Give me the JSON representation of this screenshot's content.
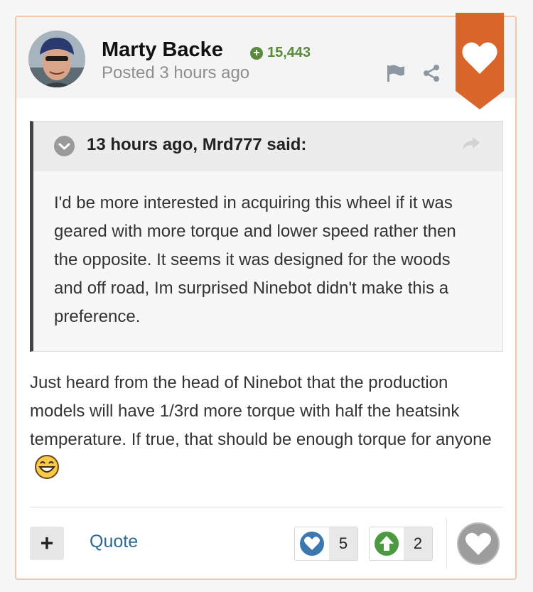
{
  "post": {
    "author": "Marty Backe",
    "reputation": "15,443",
    "posted": "Posted 3 hours ago",
    "quote": {
      "cite": "13 hours ago, Mrd777 said:",
      "text": "I'd be more interested in acquiring this wheel if it was geared with more torque and lower speed rather then the opposite. It seems it was designed for the woods and off road, Im surprised Ninebot didn't make this a preference."
    },
    "body": "Just heard from the head of Ninebot that the production models will have 1/3rd more torque with half the heatsink temperature. If true, that should be enough torque for anyone",
    "footer": {
      "plus_label": "+",
      "quote_label": "Quote",
      "reactions": [
        {
          "icon": "heart-reaction-icon",
          "count": "5"
        },
        {
          "icon": "upvote-reaction-icon",
          "count": "2"
        }
      ]
    }
  },
  "icons": [
    "flag-icon",
    "share-icon",
    "heart-icon",
    "chevron-down-icon",
    "smile-emoji-icon"
  ],
  "colors": {
    "ribbon": "#d9652a",
    "reputation": "#5a8a3c",
    "link": "#2d6a96",
    "like_reaction": "#3b78b0",
    "upvote_reaction": "#4c9a3f"
  }
}
